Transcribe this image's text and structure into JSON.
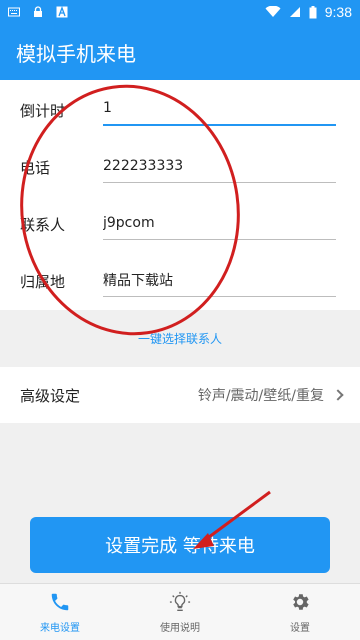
{
  "status_bar": {
    "time": "9:38",
    "icons": [
      "keyboard-icon",
      "lock-icon",
      "app-a-icon",
      "wifi-icon",
      "signal-icon",
      "battery-icon"
    ]
  },
  "app": {
    "title": "模拟手机来电"
  },
  "form": {
    "countdown_label": "倒计时",
    "countdown_value": "1",
    "phone_label": "电话",
    "phone_value": "222233333",
    "contact_label": "联系人",
    "contact_value": "j9pcom",
    "location_label": "归属地",
    "location_value": "精品下载站"
  },
  "actions": {
    "pick_contact": "一键选择联系人",
    "advanced_title": "高级设定",
    "advanced_value": "铃声/震动/壁纸/重复",
    "cta": "设置完成 等待来电"
  },
  "bottom_nav": {
    "items": [
      {
        "label": "来电设置",
        "icon": "phone-icon",
        "active": true
      },
      {
        "label": "使用说明",
        "icon": "lightbulb-icon",
        "active": false
      },
      {
        "label": "设置",
        "icon": "gear-icon",
        "active": false
      }
    ]
  },
  "colors": {
    "primary": "#2196f3",
    "annotation": "#d11f1f"
  }
}
